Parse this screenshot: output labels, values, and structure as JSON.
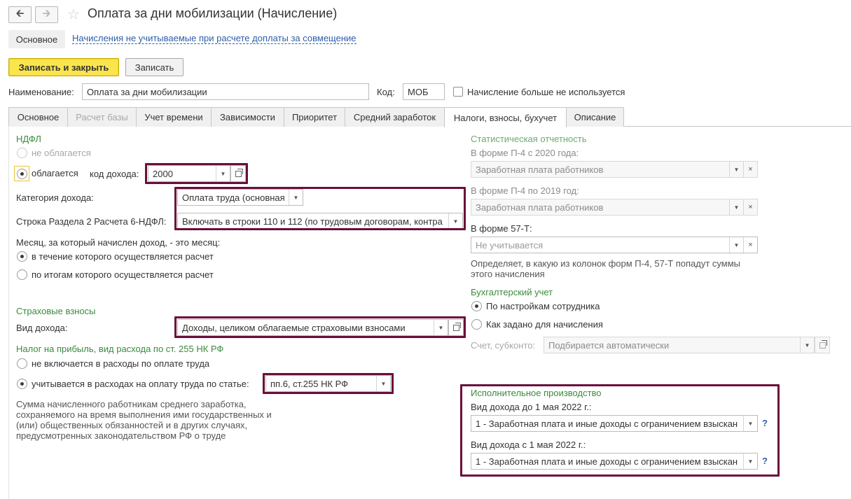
{
  "header": {
    "back_icon": "arrow-left-icon",
    "forward_icon": "arrow-right-icon",
    "favorite_icon": "star-icon",
    "title": "Оплата за дни мобилизации (Начисление)"
  },
  "top_nav": {
    "active_tab": "Основное",
    "link": "Начисления не учитываемые при расчете доплаты за совмещение"
  },
  "toolbar": {
    "save_close": "Записать и закрыть",
    "save": "Записать"
  },
  "form": {
    "name_label": "Наименование:",
    "name_value": "Оплата за дни мобилизации",
    "code_label": "Код:",
    "code_value": "МОБ",
    "not_used_label": "Начисление больше не используется",
    "not_used_checked": false
  },
  "tabs": [
    {
      "label": "Основное",
      "state": "normal"
    },
    {
      "label": "Расчет базы",
      "state": "disabled"
    },
    {
      "label": "Учет времени",
      "state": "normal"
    },
    {
      "label": "Зависимости",
      "state": "normal"
    },
    {
      "label": "Приоритет",
      "state": "normal"
    },
    {
      "label": "Средний заработок",
      "state": "normal"
    },
    {
      "label": "Налоги, взносы, бухучет",
      "state": "active"
    },
    {
      "label": "Описание",
      "state": "normal"
    }
  ],
  "ndfl": {
    "header": "НДФЛ",
    "not_taxed": "не облагается",
    "taxed": "облагается",
    "code_label": "код дохода:",
    "code_value": "2000",
    "category_label": "Категория дохода:",
    "category_value": "Оплата труда (основная",
    "row_label": "Строка Раздела 2 Расчета 6-НДФЛ:",
    "row_value": "Включать в строки 110 и 112 (по трудовым договорам, контра",
    "month_label": "Месяц, за который начислен доход, - это месяц:",
    "month_opt1": "в течение которого осуществляется расчет",
    "month_opt2": "по итогам которого осуществляется расчет"
  },
  "insurance": {
    "header": "Страховые взносы",
    "kind_label": "Вид дохода:",
    "kind_value": "Доходы, целиком облагаемые страховыми взносами"
  },
  "profit_tax": {
    "header": "Налог на прибыль, вид расхода по ст. 255 НК РФ",
    "opt1": "не включается в расходы по оплате труда",
    "opt2": "учитывается в расходах на оплату труда по статье:",
    "article_value": "пп.6, ст.255 НК РФ",
    "note": "Сумма начисленного работникам среднего заработка, сохраняемого на время выполнения ими государственных и (или) общественных обязанностей и в других случаях, предусмотренных законодательством РФ о труде"
  },
  "statistics": {
    "header": "Статистическая отчетность",
    "p4_2020_label": "В форме П-4 с 2020 года:",
    "p4_2020_value": "Заработная плата работников",
    "p4_2019_label": "В форме П-4 по 2019 год:",
    "p4_2019_value": "Заработная плата работников",
    "f57_label": "В форме 57-Т:",
    "f57_placeholder": "Не учитывается",
    "note": "Определяет, в какую из колонок форм П-4, 57-Т попадут суммы этого начисления"
  },
  "accounting": {
    "header": "Бухгалтерский учет",
    "opt1": "По настройкам сотрудника",
    "opt2": "Как задано для начисления",
    "account_label": "Счет, субконто:",
    "account_value": "Подбирается автоматически"
  },
  "enforcement": {
    "header": "Исполнительное производство",
    "before_label": "Вид дохода до 1 мая 2022 г.:",
    "before_value": "1 - Заработная плата и иные доходы с ограничением взыскан",
    "after_label": "Вид дохода с 1 мая 2022 г.:",
    "after_value": "1 - Заработная плата и иные доходы с ограничением взыскан",
    "help": "?"
  },
  "colors": {
    "accent_green": "#3b8a3c",
    "highlight_frame": "#6a0f3b",
    "primary_button": "#fbe54c",
    "link": "#2d5ea8"
  }
}
